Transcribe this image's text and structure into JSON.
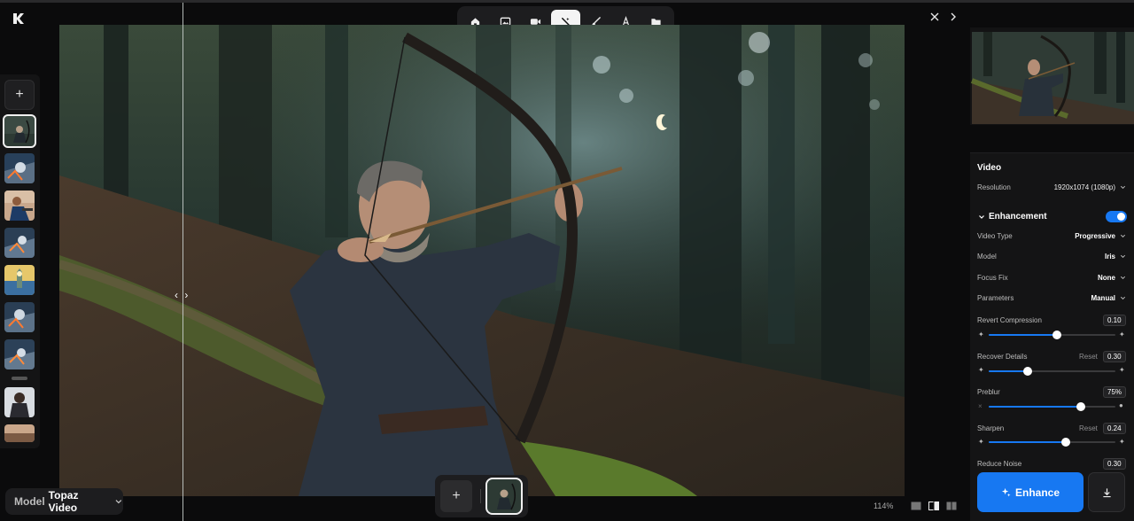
{
  "toolbar": {
    "tools": [
      {
        "icon": "home-icon"
      },
      {
        "icon": "image-icon"
      },
      {
        "icon": "video-icon"
      },
      {
        "icon": "magic-wand-icon",
        "active": true
      },
      {
        "icon": "brush-icon"
      },
      {
        "icon": "text-icon"
      },
      {
        "icon": "folder-icon"
      }
    ]
  },
  "model": {
    "label": "Model",
    "value": "Topaz Video"
  },
  "zoom": "114%",
  "panel": {
    "video_title": "Video",
    "resolution": {
      "label": "Resolution",
      "value": "1920x1074 (1080p)"
    },
    "enhancement_title": "Enhancement",
    "enhancement_enabled": true,
    "video_type": {
      "label": "Video Type",
      "value": "Progressive"
    },
    "model": {
      "label": "Model",
      "value": "Iris"
    },
    "focus_fix": {
      "label": "Focus Fix",
      "value": "None"
    },
    "parameters": {
      "label": "Parameters",
      "value": "Manual"
    },
    "sliders": [
      {
        "label": "Revert Compression",
        "value": "0.10",
        "reset": "",
        "level": 0.54
      },
      {
        "label": "Recover Details",
        "value": "0.30",
        "reset": "Reset",
        "level": 0.31
      },
      {
        "label": "Preblur",
        "value": "75%",
        "reset": "",
        "level": 0.73
      },
      {
        "label": "Sharpen",
        "value": "0.24",
        "reset": "Reset",
        "level": 0.61
      },
      {
        "label": "Reduce Noise",
        "value": "0.30",
        "reset": "",
        "level": null
      }
    ],
    "enhance_label": "Enhance"
  },
  "colors": {
    "accent": "#1778f2",
    "panel_bg": "#141415",
    "app_bg": "#0b0b0c"
  }
}
